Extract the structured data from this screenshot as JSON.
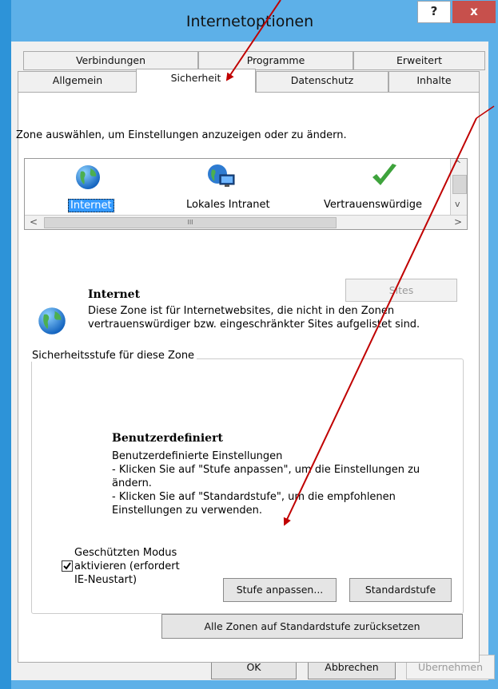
{
  "window": {
    "title": "Internetoptionen",
    "help_label": "?",
    "close_label": "x"
  },
  "tabs": [
    {
      "label": "Verbindungen"
    },
    {
      "label": "Programme"
    },
    {
      "label": "Erweitert"
    },
    {
      "label": "Allgemein"
    },
    {
      "label": "Sicherheit",
      "active": true
    },
    {
      "label": "Datenschutz"
    },
    {
      "label": "Inhalte"
    }
  ],
  "zones": {
    "instruction": "Zone auswählen, um Einstellungen anzuzeigen oder zu ändern.",
    "items": [
      {
        "label": "Internet",
        "icon": "globe-icon",
        "selected": true
      },
      {
        "label": "Lokales Intranet",
        "icon": "intranet-icon"
      },
      {
        "label": "Vertrauenswürdige",
        "icon": "checkmark-icon"
      }
    ],
    "scroll_up": "^",
    "scroll_down": "v",
    "scroll_left": "<",
    "scroll_right": ">",
    "scroll_grip": "III"
  },
  "sites_button": "Sites",
  "zone_info": {
    "title": "Internet",
    "description": "Diese Zone ist für Internetwebsites, die nicht in den Zonen vertrauenswürdiger bzw. eingeschränkter Sites aufgelistet sind."
  },
  "security_level": {
    "group_label": "Sicherheitsstufe für diese Zone",
    "level_name": "Benutzerdefiniert",
    "lines": [
      "Benutzerdefinierte Einstellungen",
      "- Klicken Sie auf \"Stufe anpassen\", um die Einstellungen zu",
      "ändern.",
      "- Klicken Sie auf \"Standardstufe\", um die empfohlenen",
      "Einstellungen zu verwenden."
    ],
    "protected_mode": {
      "lines": [
        "Geschützten Modus",
        "aktivieren (erfordert",
        "IE-Neustart)"
      ],
      "checked": true
    },
    "customize_button": "Stufe anpassen...",
    "default_button": "Standardstufe"
  },
  "reset_all_button": "Alle Zonen auf Standardstufe zurücksetzen",
  "footer": {
    "ok": "OK",
    "cancel": "Abbrechen",
    "apply": "Übernehmen"
  },
  "colors": {
    "frame": "#5db0e8",
    "close": "#c7504c",
    "selection": "#3399ff",
    "annotation": "#c00000"
  }
}
